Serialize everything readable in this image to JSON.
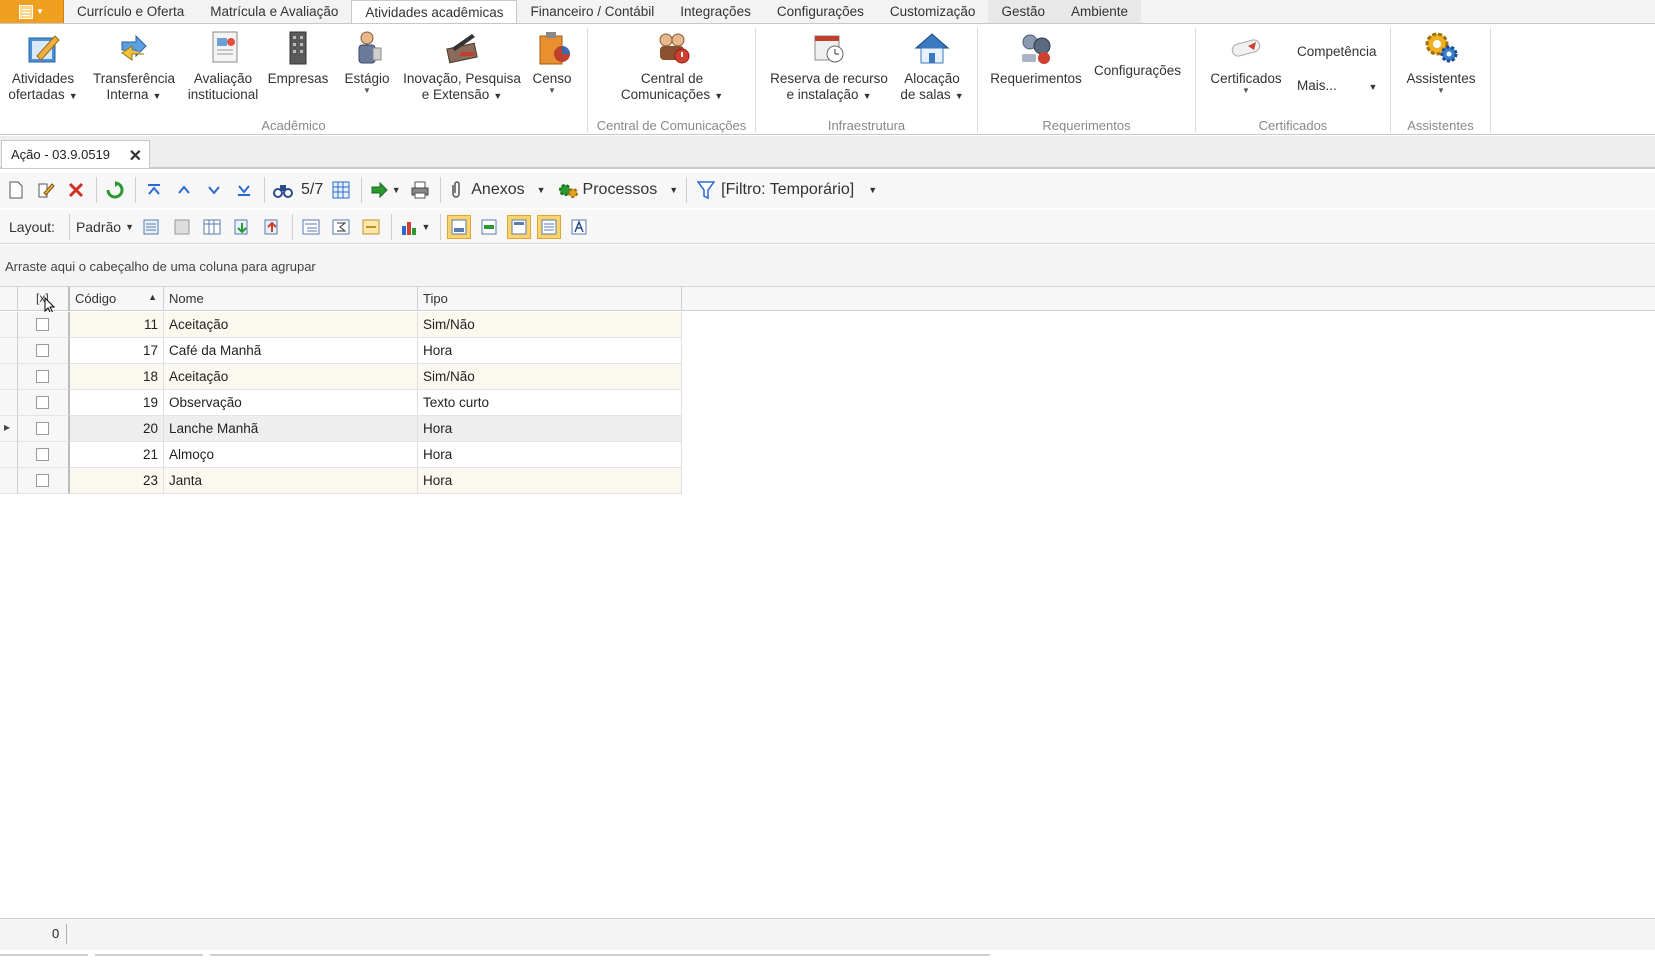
{
  "menu": {
    "tabs": [
      "Currículo e Oferta",
      "Matrícula e Avaliação",
      "Atividades acadêmicas",
      "Financeiro / Contábil",
      "Integrações",
      "Configurações",
      "Customização",
      "Gestão",
      "Ambiente"
    ],
    "active_index": 2
  },
  "ribbon": {
    "atividades": {
      "l1": "Atividades",
      "l2": "ofertadas"
    },
    "transferencia": {
      "l1": "Transferência",
      "l2": "Interna"
    },
    "avaliacao": {
      "l1": "Avaliação",
      "l2": "institucional"
    },
    "empresas": {
      "l1": "Empresas"
    },
    "estagio": {
      "l1": "Estágio"
    },
    "inovacao": {
      "l1": "Inovação, Pesquisa",
      "l2": "e Extensão"
    },
    "censo": {
      "l1": "Censo"
    },
    "central": {
      "l1": "Central de",
      "l2": "Comunicações"
    },
    "reserva": {
      "l1": "Reserva de recurso",
      "l2": "e instalação"
    },
    "alocacao": {
      "l1": "Alocação",
      "l2": "de salas"
    },
    "requerimentos": {
      "l1": "Requerimentos"
    },
    "configuracoes": {
      "l1": "Configurações"
    },
    "certificados": {
      "l1": "Certificados"
    },
    "competencia": {
      "l1": "Competência"
    },
    "mais": {
      "l1": "Mais..."
    },
    "assistentes": {
      "l1": "Assistentes"
    },
    "groups": {
      "academico": "Acadêmico",
      "central": "Central de Comunicações",
      "infra": "Infraestrutura",
      "requerimentos": "Requerimentos",
      "certificados": "Certificados",
      "assistentes": "Assistentes"
    }
  },
  "doc_tab": {
    "title": "Ação - 03.9.0519",
    "close": "✕"
  },
  "toolbar": {
    "record_counter": "5/7",
    "anexos": "Anexos",
    "processos": "Processos",
    "filtro": "[Filtro: Temporário]",
    "layout_label": "Layout:",
    "layout_value": "Padrão"
  },
  "group_panel": {
    "text": "Arraste aqui o cabeçalho de uma coluna para agrupar"
  },
  "grid": {
    "columns": {
      "codigo": "Código",
      "nome": "Nome",
      "tipo": "Tipo"
    },
    "rows": [
      {
        "codigo": "11",
        "nome": "Aceitação",
        "tipo": "Sim/Não"
      },
      {
        "codigo": "17",
        "nome": "Café da Manhã",
        "tipo": "Hora"
      },
      {
        "codigo": "18",
        "nome": "Aceitação",
        "tipo": "Sim/Não"
      },
      {
        "codigo": "19",
        "nome": "Observação",
        "tipo": "Texto curto"
      },
      {
        "codigo": "20",
        "nome": "Lanche Manhã",
        "tipo": "Hora"
      },
      {
        "codigo": "21",
        "nome": "Almoço",
        "tipo": "Hora"
      },
      {
        "codigo": "23",
        "nome": "Janta",
        "tipo": "Hora"
      }
    ],
    "focused_row": 4
  },
  "status": {
    "count": "0"
  },
  "colors": {
    "accent_orange": "#f0a020",
    "highlight": "#fbd56b"
  }
}
